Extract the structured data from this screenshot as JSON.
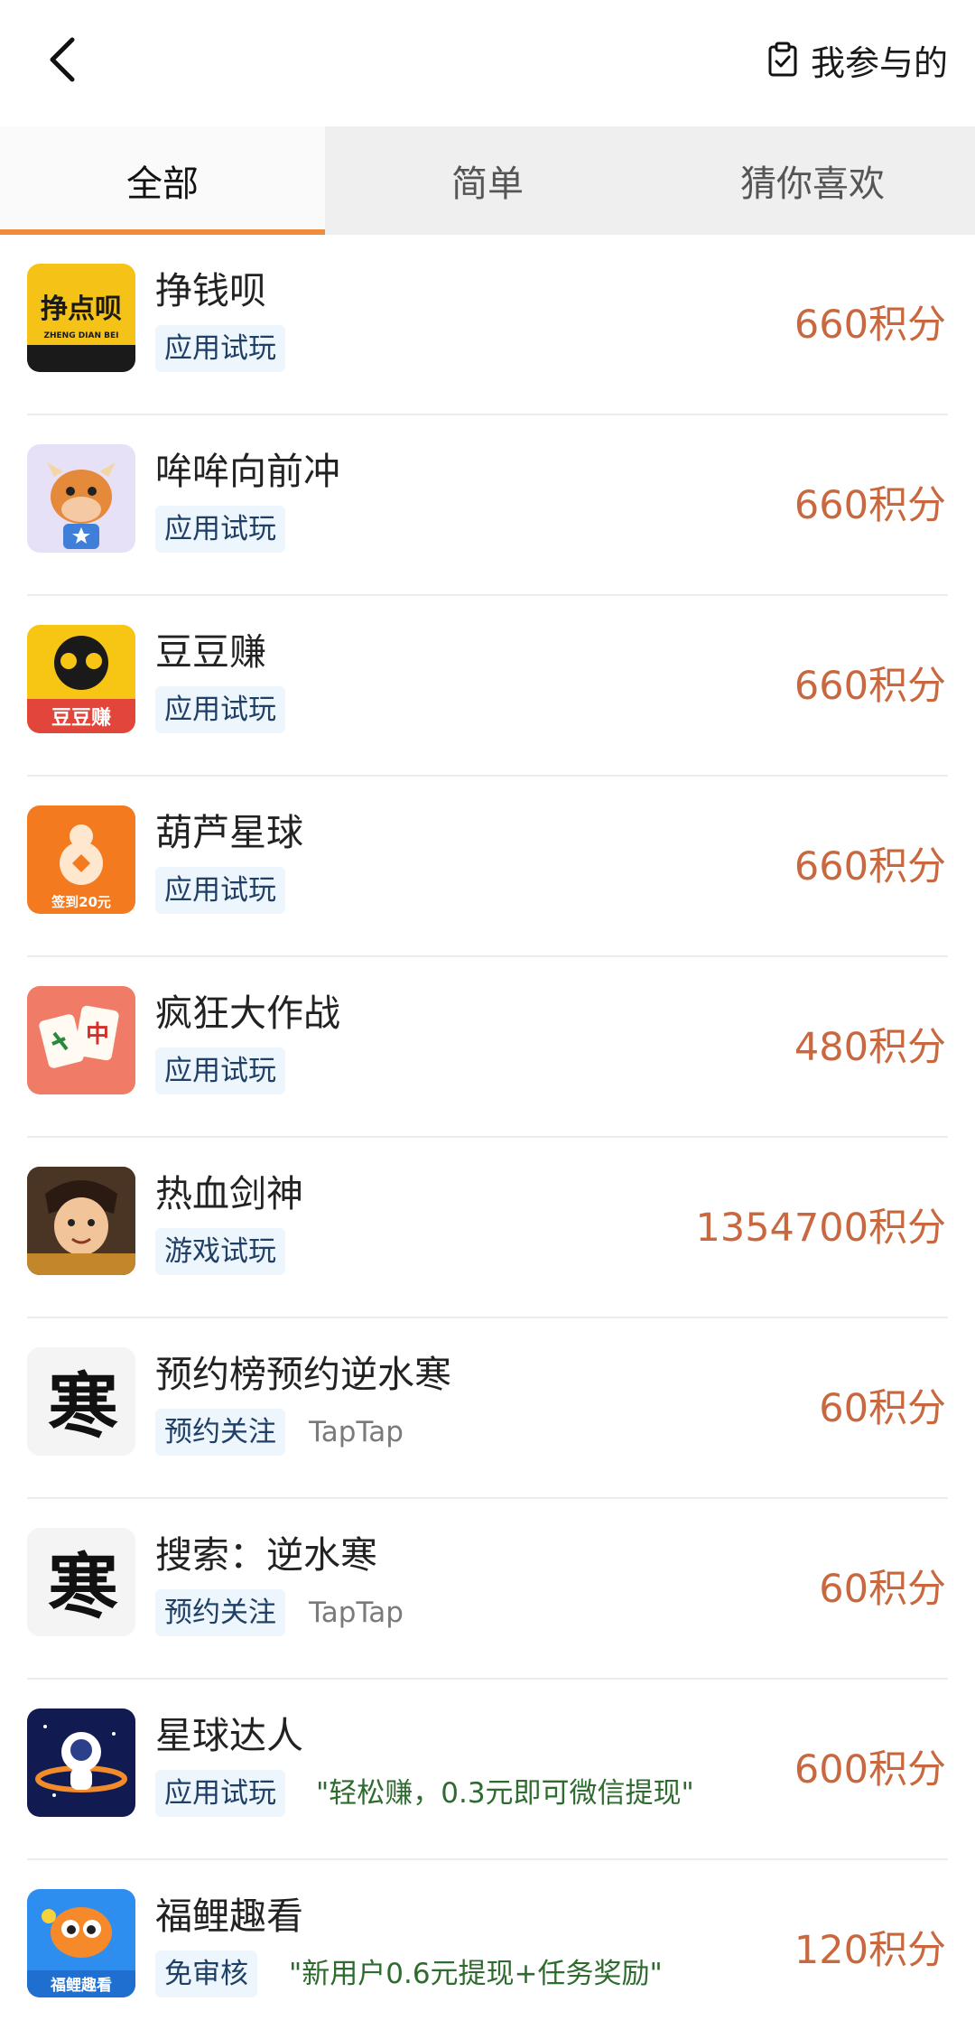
{
  "header": {
    "mine_label": "我参与的"
  },
  "tabs": [
    {
      "label": "全部"
    },
    {
      "label": "简单"
    },
    {
      "label": "猜你喜欢"
    }
  ],
  "items": [
    {
      "title": "挣钱呗",
      "tag": "应用试玩",
      "extra": "",
      "points": "660积分",
      "icon": "zhengqianbei-app-icon",
      "icon_text": "挣点呗",
      "icon_subtext": "ZHENG DIAN BEI"
    },
    {
      "title": "哞哞向前冲",
      "tag": "应用试玩",
      "extra": "",
      "points": "660积分",
      "icon": "cow-mascot-app-icon"
    },
    {
      "title": "豆豆赚",
      "tag": "应用试玩",
      "extra": "",
      "points": "660积分",
      "icon": "doudouzhuan-app-icon",
      "icon_text": "豆豆赚"
    },
    {
      "title": "葫芦星球",
      "tag": "应用试玩",
      "extra": "",
      "points": "660积分",
      "icon": "gourd-app-icon",
      "icon_text": "签到20元"
    },
    {
      "title": "疯狂大作战",
      "tag": "应用试玩",
      "extra": "",
      "points": "480积分",
      "icon": "mahjong-tiles-app-icon",
      "icon_text": "中"
    },
    {
      "title": "热血剑神",
      "tag": "游戏试玩",
      "extra": "",
      "points": "1354700积分",
      "icon": "swordsman-game-icon"
    },
    {
      "title": "预约榜预约逆水寒",
      "tag": "预约关注",
      "extra": "TapTap",
      "points": "60积分",
      "icon": "nishuihan-calligraphy-icon",
      "icon_text": "寒"
    },
    {
      "title": "搜索：逆水寒",
      "tag": "预约关注",
      "extra": "TapTap",
      "points": "60积分",
      "icon": "nishuihan-calligraphy-icon",
      "icon_text": "寒"
    },
    {
      "title": "星球达人",
      "tag": "应用试玩",
      "extra": "\"轻松赚，0.3元即可微信提现\"",
      "points": "600积分",
      "icon": "astronaut-planet-app-icon"
    },
    {
      "title": "福鲤趣看",
      "tag": "免审核",
      "extra": "\"新用户0.6元提现+任务奖励\"",
      "points": "120积分",
      "icon": "fuli-fish-app-icon",
      "icon_text": "福鲤趣看"
    }
  ],
  "colors": {
    "accent": "#f08a3c",
    "points": "#c9683f",
    "tag_bg": "#eef6fd",
    "tag_text": "#1f3f66"
  }
}
